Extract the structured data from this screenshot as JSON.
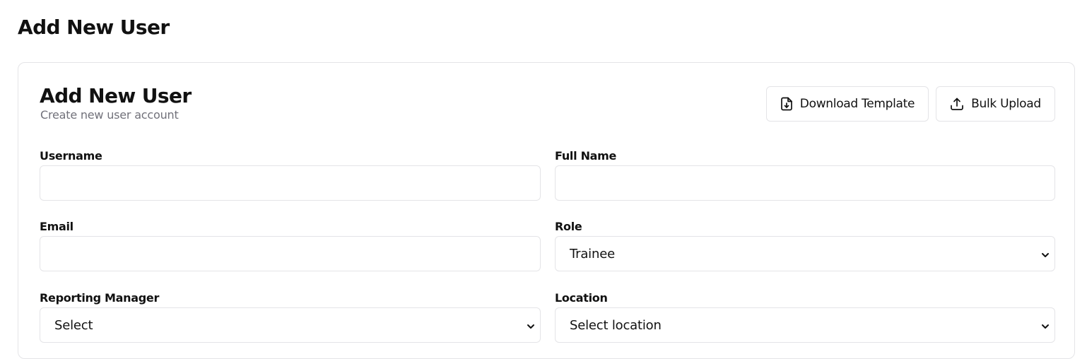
{
  "page": {
    "title": "Add New User"
  },
  "card": {
    "title": "Add New User",
    "subtitle": "Create new user account"
  },
  "actions": {
    "download_label": "Download Template",
    "download_icon": "file-download-icon",
    "upload_label": "Bulk Upload",
    "upload_icon": "upload-icon"
  },
  "form": {
    "username": {
      "label": "Username",
      "value": "",
      "placeholder": ""
    },
    "full_name": {
      "label": "Full Name",
      "value": "",
      "placeholder": ""
    },
    "email": {
      "label": "Email",
      "value": "",
      "placeholder": ""
    },
    "role": {
      "label": "Role",
      "selected": "Trainee"
    },
    "reporting_manager": {
      "label": "Reporting Manager",
      "selected": "Select"
    },
    "location": {
      "label": "Location",
      "selected": "Select location"
    }
  },
  "colors": {
    "border": "#e4e4e7",
    "muted_text": "#71717a",
    "text": "#111111"
  }
}
